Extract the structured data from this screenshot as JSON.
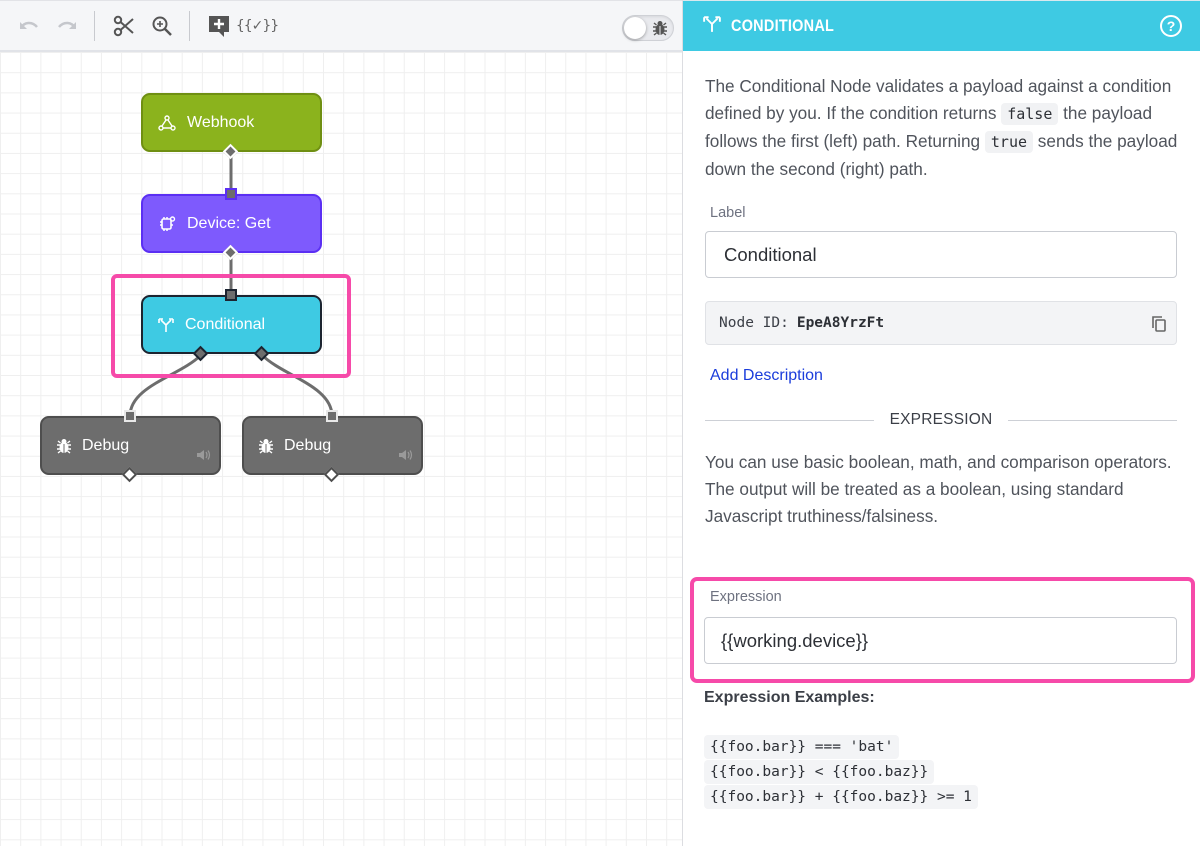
{
  "toolbar": {
    "buttons": [
      {
        "name": "undo",
        "icon": "undo-icon",
        "enabled": false
      },
      {
        "name": "redo",
        "icon": "redo-icon",
        "enabled": false
      },
      {
        "name": "cut",
        "icon": "scissors-icon",
        "enabled": true
      },
      {
        "name": "zoom",
        "icon": "zoom-in-icon",
        "enabled": true
      },
      {
        "name": "add-note",
        "icon": "add-comment-icon",
        "enabled": true
      },
      {
        "name": "expression-helper",
        "icon": "template-check-icon",
        "label": "{{✓}}",
        "enabled": true
      }
    ],
    "debug_toggle": {
      "on": false,
      "icon": "bug-icon"
    }
  },
  "canvas": {
    "nodes": [
      {
        "id": "webhook",
        "label": "Webhook",
        "icon": "webhook-icon",
        "color": "#8bb31d"
      },
      {
        "id": "device-get",
        "label": "Device: Get",
        "icon": "device-chip-icon",
        "color": "#7e5afd"
      },
      {
        "id": "conditional",
        "label": "Conditional",
        "icon": "fork-icon",
        "color": "#3ecae3",
        "selected": true
      },
      {
        "id": "debug-1",
        "label": "Debug",
        "icon": "bug-icon",
        "color": "#6d6d6d"
      },
      {
        "id": "debug-2",
        "label": "Debug",
        "icon": "bug-icon",
        "color": "#6d6d6d"
      }
    ],
    "connections": [
      [
        "webhook",
        "device-get"
      ],
      [
        "device-get",
        "conditional"
      ],
      [
        "conditional",
        "debug-1"
      ],
      [
        "conditional",
        "debug-2"
      ]
    ]
  },
  "panel": {
    "header": {
      "title": "CONDITIONAL",
      "icon": "fork-icon",
      "help_icon": "help-circle-icon",
      "color": "#3ecae3"
    },
    "description": {
      "part1": "The Conditional Node validates a payload against a condition defined by you. If the condition returns ",
      "code1": "false",
      "part2": " the payload follows the first (left) path. Returning ",
      "code2": "true",
      "part3": " sends the payload down the second (right) path."
    },
    "label_field": {
      "label": "Label",
      "value": "Conditional"
    },
    "node_id": {
      "label": "Node ID:",
      "value": "EpeA8YrzFt"
    },
    "add_description": "Add Description",
    "section_title": "EXPRESSION",
    "expression_help": "You can use basic boolean, math, and comparison operators. The output will be treated as a boolean, using standard Javascript truthiness/falsiness.",
    "expression_field": {
      "label": "Expression",
      "value": "{{working.device}}"
    },
    "examples_title": "Expression Examples:",
    "examples": [
      "{{foo.bar}} === 'bat'",
      "{{foo.bar}} < {{foo.baz}}",
      "{{foo.bar}} + {{foo.baz}} >= 1"
    ]
  },
  "highlight_color": "#f64aa9"
}
